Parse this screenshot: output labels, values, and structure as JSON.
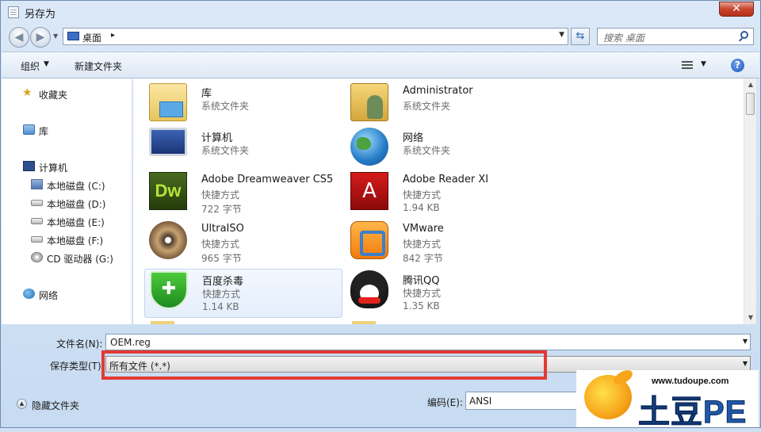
{
  "window": {
    "title": "另存为",
    "close": "✕"
  },
  "address": {
    "location": "桌面",
    "arrow": "▸",
    "search_placeholder": "搜索 桌面"
  },
  "toolbar": {
    "organize": "组织",
    "new_folder": "新建文件夹"
  },
  "sidebar": {
    "favorites": "收藏夹",
    "libraries": "库",
    "computer": "计算机",
    "drives": [
      "本地磁盘 (C:)",
      "本地磁盘 (D:)",
      "本地磁盘 (E:)",
      "本地磁盘 (F:)",
      "CD 驱动器 (G:)"
    ],
    "network": "网络"
  },
  "files": [
    {
      "name": "库",
      "type": "系统文件夹",
      "size": "",
      "icon": "library-folder-icon"
    },
    {
      "name": "Administrator",
      "type": "系统文件夹",
      "size": "",
      "icon": "user-folder-icon"
    },
    {
      "name": "计算机",
      "type": "系统文件夹",
      "size": "",
      "icon": "computer-icon"
    },
    {
      "name": "网络",
      "type": "系统文件夹",
      "size": "",
      "icon": "network-globe-icon"
    },
    {
      "name": "Adobe Dreamweaver CS5",
      "type": "快捷方式",
      "size": "722 字节",
      "icon": "dreamweaver-icon",
      "glyph": "Dw"
    },
    {
      "name": "Adobe Reader XI",
      "type": "快捷方式",
      "size": "1.94 KB",
      "icon": "adobe-reader-icon",
      "glyph": "A"
    },
    {
      "name": "UltraISO",
      "type": "快捷方式",
      "size": "965 字节",
      "icon": "disc-icon"
    },
    {
      "name": "VMware",
      "type": "快捷方式",
      "size": "842 字节",
      "icon": "vmware-icon"
    },
    {
      "name": "百度杀毒",
      "type": "快捷方式",
      "size": "1.14 KB",
      "icon": "shield-icon",
      "glyph": "✚"
    },
    {
      "name": "腾讯QQ",
      "type": "快捷方式",
      "size": "1.35 KB",
      "icon": "qq-penguin-icon"
    }
  ],
  "form": {
    "filename_label": "文件名(N):",
    "filename_value": "OEM.reg",
    "filetype_label": "保存类型(T):",
    "filetype_value": "所有文件  (*.*)",
    "encoding_label": "编码(E):",
    "encoding_value": "ANSI",
    "hide_folders": "隐藏文件夹"
  },
  "watermark": {
    "url": "www.tudoupe.com",
    "brand": "土豆PE"
  },
  "colors": {
    "highlight": "#e23a33",
    "accent": "#1f59a8"
  }
}
